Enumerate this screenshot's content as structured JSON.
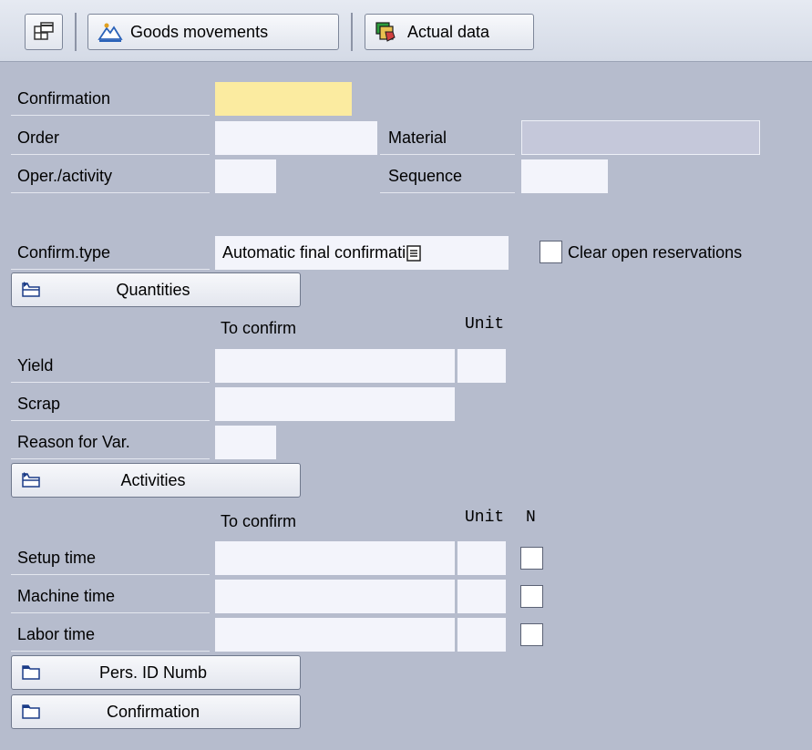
{
  "toolbar": {
    "goods_movements": "Goods movements",
    "actual_data": "Actual data"
  },
  "header": {
    "confirmation_label": "Confirmation",
    "confirmation_value": "",
    "order_label": "Order",
    "order_value": "",
    "material_label": "Material",
    "material_value": "",
    "oper_label": "Oper./activity",
    "oper_value": "",
    "sequence_label": "Sequence",
    "sequence_value": "",
    "confirm_type_label": "Confirm.type",
    "confirm_type_value": "Automatic final confirmati",
    "clear_reservations_label": "Clear open reservations",
    "clear_reservations_checked": false
  },
  "quantities": {
    "section_button": "Quantities",
    "col_to_confirm": "To confirm",
    "col_unit": "Unit",
    "yield_label": "Yield",
    "scrap_label": "Scrap",
    "reason_label": "Reason for Var."
  },
  "activities": {
    "section_button": "Activities",
    "col_to_confirm": "To confirm",
    "col_unit": "Unit",
    "col_n": "N",
    "rows": [
      {
        "label": "Setup time",
        "value": "",
        "unit": "",
        "checked": false
      },
      {
        "label": "Machine time",
        "value": "",
        "unit": "",
        "checked": false
      },
      {
        "label": "Labor time",
        "value": "",
        "unit": "",
        "checked": false
      }
    ]
  },
  "footer": {
    "pers_id_button": "Pers. ID Numb",
    "confirmation_button": "Confirmation"
  }
}
